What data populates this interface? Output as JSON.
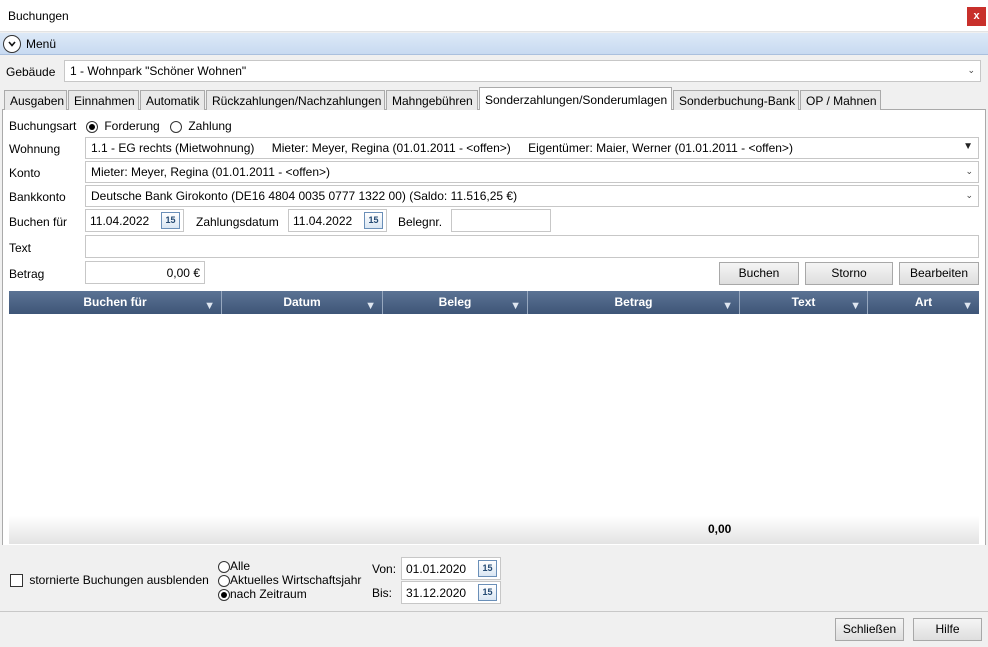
{
  "window": {
    "title": "Buchungen",
    "close_label": "x"
  },
  "menu": {
    "label": "Menü",
    "toggle_icon": "chevron-down-icon"
  },
  "gebaeude": {
    "label": "Gebäude",
    "value": "1 - Wohnpark \"Schöner Wohnen\""
  },
  "tabs": [
    {
      "label": "Ausgaben"
    },
    {
      "label": "Einnahmen"
    },
    {
      "label": "Automatik"
    },
    {
      "label": "Rückzahlungen/Nachzahlungen"
    },
    {
      "label": "Mahngebühren"
    },
    {
      "label": "Sonderzahlungen/Sonderumlagen"
    },
    {
      "label": "Sonderbuchung-Bank"
    },
    {
      "label": "OP / Mahnen"
    }
  ],
  "form": {
    "buchungsart": {
      "label": "Buchungsart",
      "options": [
        "Forderung",
        "Zahlung"
      ],
      "selected": "Forderung"
    },
    "wohnung": {
      "label": "Wohnung",
      "value": "1.1 - EG rechts (Mietwohnung)",
      "mieter": "Mieter: Meyer, Regina (01.01.2011 - <offen>)",
      "eigentuemer": "Eigentümer: Maier, Werner (01.01.2011 - <offen>)"
    },
    "konto": {
      "label": "Konto",
      "value": "Mieter: Meyer, Regina (01.01.2011 - <offen>)"
    },
    "bankkonto": {
      "label": "Bankkonto",
      "value": "Deutsche Bank Girokonto (DE16 4804 0035 0777 1322 00) (Saldo: 11.516,25 €)"
    },
    "buchen_fuer": {
      "label": "Buchen für",
      "value": "11.04.2022"
    },
    "zahlungsdatum": {
      "label": "Zahlungsdatum",
      "value": "11.04.2022"
    },
    "belegnr": {
      "label": "Belegnr.",
      "value": ""
    },
    "text": {
      "label": "Text",
      "value": ""
    },
    "betrag": {
      "label": "Betrag",
      "value": "0,00 €"
    },
    "calendar_day": "15"
  },
  "actions": {
    "buchen": "Buchen",
    "storno": "Storno",
    "bearbeiten": "Bearbeiten"
  },
  "grid": {
    "columns": [
      "Buchen für",
      "Datum",
      "Beleg",
      "Betrag",
      "Text",
      "Art"
    ],
    "rows": [],
    "total": "0,00"
  },
  "filter": {
    "hide_storno_label": "stornierte Buchungen ausblenden",
    "hide_storno_checked": false,
    "range_options": [
      "Alle",
      "Aktuelles Wirtschaftsjahr",
      "nach Zeitraum"
    ],
    "range_selected": "nach Zeitraum",
    "von_label": "Von:",
    "von_value": "01.01.2020",
    "bis_label": "Bis:",
    "bis_value": "31.12.2020"
  },
  "footer": {
    "schliessen": "Schließen",
    "hilfe": "Hilfe"
  },
  "colors": {
    "grid_header": "#4a6285",
    "menubar": "#d3e2f4",
    "close_button": "#c8302b"
  }
}
